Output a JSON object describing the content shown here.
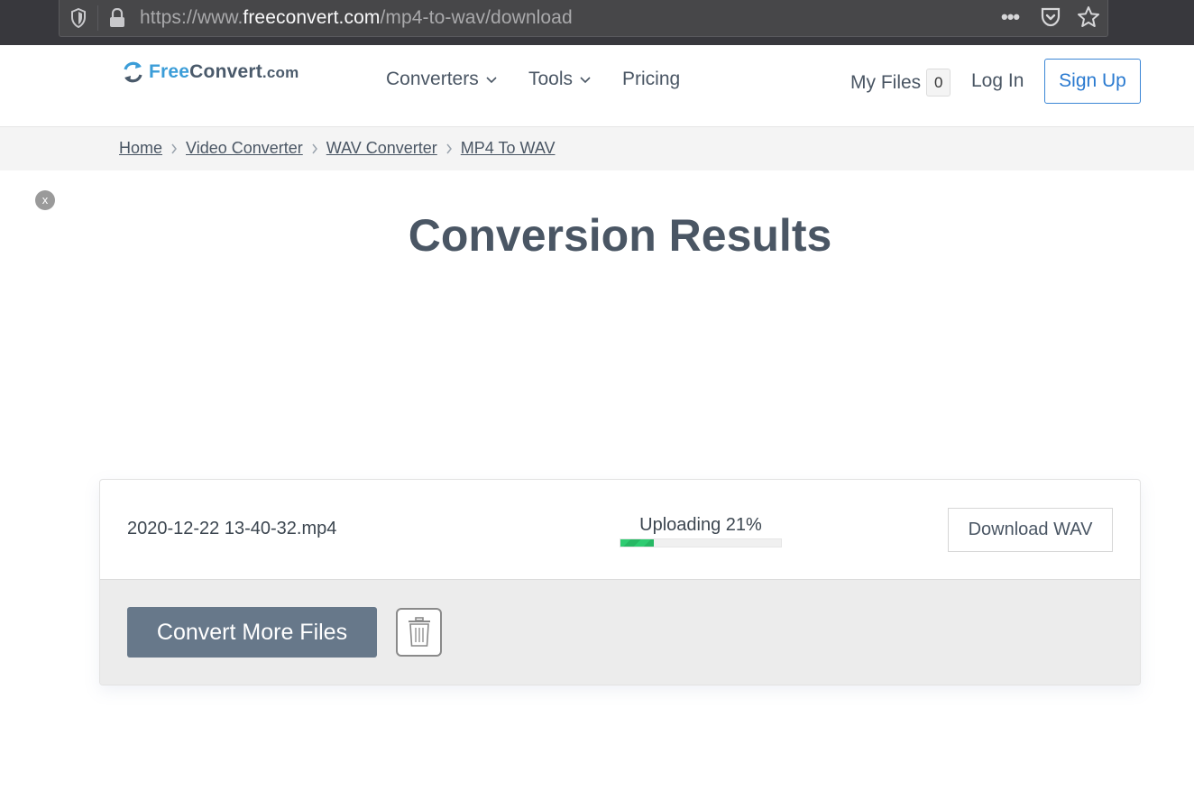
{
  "browser": {
    "url_prefix": "https://www.",
    "url_host": "freeconvert.com",
    "url_path": "/mp4-to-wav/download",
    "menu_glyph": "•••"
  },
  "header": {
    "logo_free": "Free",
    "logo_convert": "Convert",
    "logo_dotcom": ".com",
    "nav": {
      "converters": "Converters",
      "tools": "Tools",
      "pricing": "Pricing"
    },
    "my_files_label": "My Files",
    "my_files_count": "0",
    "login": "Log In",
    "signup": "Sign Up"
  },
  "breadcrumb": {
    "items": [
      "Home",
      "Video Converter",
      "WAV Converter",
      "MP4 To WAV"
    ]
  },
  "close_ad": "x",
  "main": {
    "title": "Conversion Results",
    "file": {
      "name": "2020-12-22 13-40-32.mp4",
      "status": "Uploading 21%",
      "progress_percent": 21,
      "download_label": "Download WAV"
    },
    "convert_more": "Convert More Files"
  },
  "colors": {
    "accent_blue": "#2a7ad0",
    "progress_green": "#2ecc71",
    "primary_button": "#67788a",
    "text": "#4a5664"
  },
  "icons": [
    "shield-icon",
    "lock-icon",
    "more-icon",
    "pocket-icon",
    "star-icon",
    "refresh-logo-icon",
    "chevron-down-icon",
    "chevron-right-icon",
    "trash-icon"
  ]
}
